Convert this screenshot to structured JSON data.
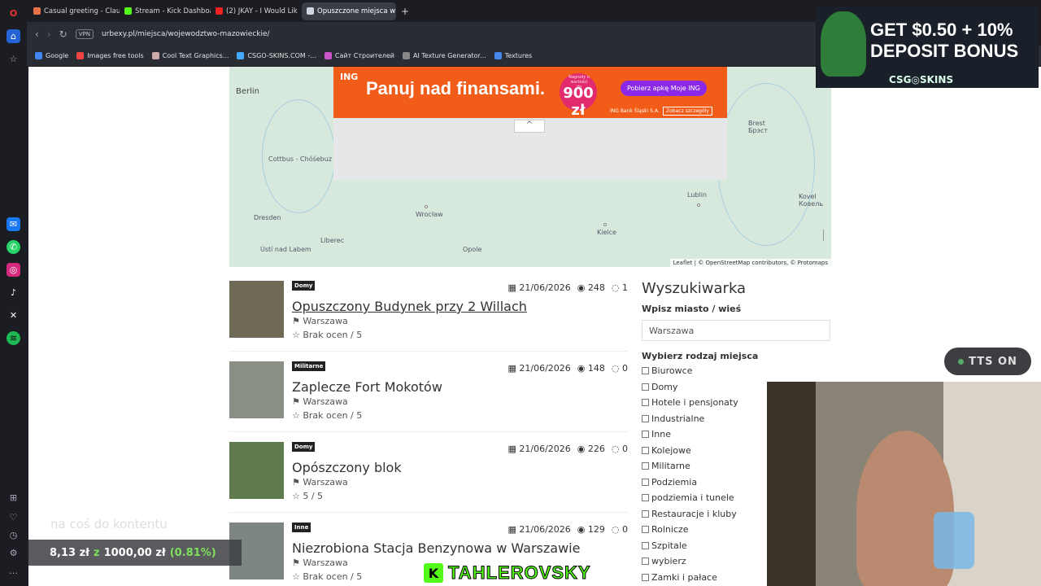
{
  "browser": {
    "tabs": [
      {
        "label": "Casual greeting - Claude",
        "color": "#e8704a"
      },
      {
        "label": "Stream - Kick Dashboard",
        "color": "#53fc18"
      },
      {
        "label": "(2) JKAY - I Would Lik",
        "color": "#e22"
      },
      {
        "label": "Opuszczone miejsca w wo",
        "color": "#d0d6e0"
      }
    ],
    "new_tab": "+",
    "vpn": "VPN",
    "url": "urbexy.pl/miejsca/wojewodztwo-mazowieckie/",
    "bookmarks": [
      {
        "label": "Google",
        "color": "#4285f4"
      },
      {
        "label": "Images free tools",
        "color": "#e44"
      },
      {
        "label": "Cool Text Graphics...",
        "color": "#caa"
      },
      {
        "label": "CSGO-SKINS.COM -...",
        "color": "#4af"
      },
      {
        "label": "Сайт Строителей",
        "color": "#c5c"
      },
      {
        "label": "AI Texture Generator...",
        "color": "#888"
      },
      {
        "label": "Textures",
        "color": "#48e"
      }
    ]
  },
  "map": {
    "cities": [
      {
        "name": "Berlin"
      },
      {
        "name": "Cottbus - Chóśebuz"
      },
      {
        "name": "Dresden"
      },
      {
        "name": "Wrocław"
      },
      {
        "name": "Liberec"
      },
      {
        "name": "Ústí nad Labem"
      },
      {
        "name": "Opole"
      },
      {
        "name": "Kielce"
      },
      {
        "name": "Lublin"
      },
      {
        "name": "Brest\nБрэст"
      },
      {
        "name": "Kovel\nКовель"
      }
    ],
    "attribution": "Leaflet | © OpenStreetMap contributors, © Protomaps",
    "ad": {
      "logo": "ING",
      "slogan": "Panuj nad finansami.",
      "badge_top": "Nagrody o wartości do",
      "badge_value": "900 zł",
      "cta": "Pobierz apkę Moje ING",
      "bank": "ING Bank Śląski S.A.",
      "more": "Zobacz szczegóły"
    },
    "chevron": "^"
  },
  "listings": [
    {
      "category": "Domy",
      "date": "21/06/2026",
      "views": "248",
      "comments": "1",
      "title": "Opuszczony Budynek przy 2 Willach",
      "city": "Warszawa",
      "rating": "Brak ocen / 5",
      "thumb": "#6f6a55"
    },
    {
      "category": "Militarne",
      "date": "21/06/2026",
      "views": "148",
      "comments": "0",
      "title": "Zaplecze Fort Mokotów",
      "city": "Warszawa",
      "rating": "Brak ocen / 5",
      "thumb": "#8a8f86"
    },
    {
      "category": "Domy",
      "date": "21/06/2026",
      "views": "226",
      "comments": "0",
      "title": "Opószczony blok",
      "city": "Warszawa",
      "rating": "5 / 5",
      "thumb": "#5f7a4c"
    },
    {
      "category": "Inne",
      "date": "21/06/2026",
      "views": "129",
      "comments": "0",
      "title": "Niezrobiona Stacja Benzynowa w Warszawie",
      "city": "Warszawa",
      "rating": "Brak ocen / 5",
      "thumb": "#7c8581"
    }
  ],
  "sidebar": {
    "title": "Wyszukiwarka",
    "city_label": "Wpisz miasto / wieś",
    "city_value": "Warszawa",
    "type_label": "Wybierz rodzaj miejsca",
    "types": [
      "Biurowce",
      "Domy",
      "Hotele i pensjonaty",
      "Industrialne",
      "Inne",
      "Kolejowe",
      "Militarne",
      "Podziemia",
      "podziemia i tunele",
      "Restauracje i kluby",
      "Rolnicze",
      "Szpitale",
      "wybierz",
      "Zamki i pałace"
    ]
  },
  "overlays": {
    "promo_line1": "GET $0.50 + 10%",
    "promo_line2": "DEPOSIT BONUS",
    "promo_brand": "CSG◎SKINS",
    "tts": "TTS ON",
    "subtitle": "na coś do kontentu",
    "earn_current": "8,13 zł",
    "earn_sep": "z",
    "earn_goal": "1000,00 zł",
    "earn_pct": "(0.81%)",
    "kick_letter": "K",
    "streamer": "TAHLEROVSKY"
  }
}
